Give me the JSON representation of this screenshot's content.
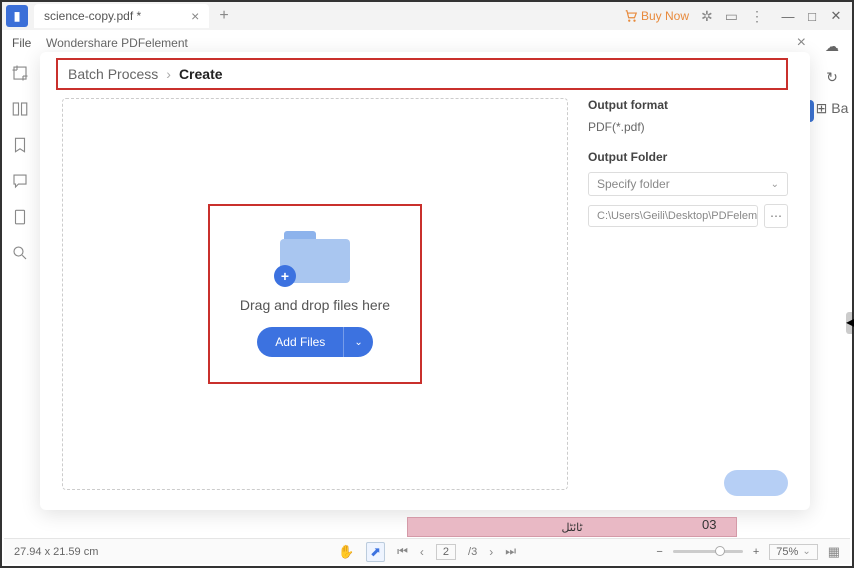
{
  "topbar": {
    "tab_title": "science-copy.pdf *",
    "buy_now": "Buy Now"
  },
  "menubar": {
    "file": "File"
  },
  "right_tools": {
    "batch": "Ba"
  },
  "modal": {
    "title": "Wondershare PDFelement",
    "breadcrumb": {
      "root": "Batch Process",
      "current": "Create"
    },
    "dropzone": {
      "text": "Drag and drop files here",
      "add_files": "Add Files"
    },
    "panel": {
      "format_label": "Output format",
      "format_value": "PDF(*.pdf)",
      "folder_label": "Output Folder",
      "folder_select": "Specify folder",
      "folder_path": "C:\\Users\\Geili\\Desktop\\PDFelement\\Cr"
    }
  },
  "background": {
    "num": "03",
    "center_text": "ٹائٹل"
  },
  "status": {
    "dimensions": "27.94 x 21.59 cm",
    "page_current": "2",
    "page_total": "/3",
    "zoom": "75%"
  }
}
